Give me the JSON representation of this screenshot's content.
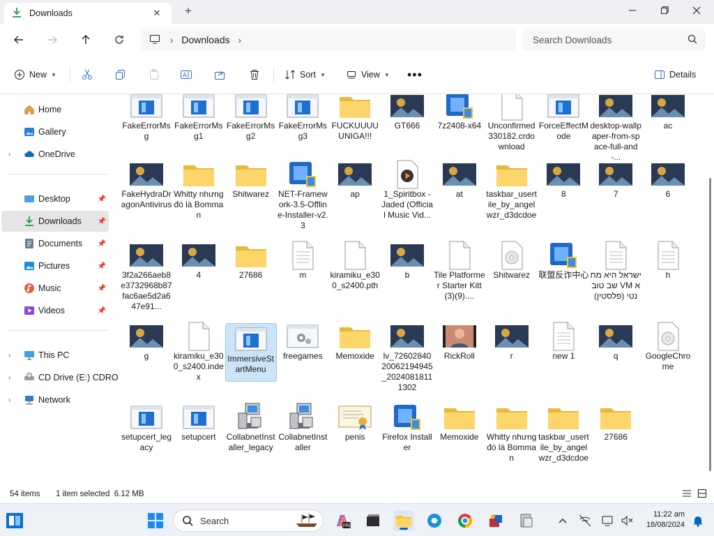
{
  "window": {
    "tab_title": "Downloads",
    "breadcrumb": "Downloads",
    "search_placeholder": "Search Downloads"
  },
  "commands": {
    "new": "New",
    "sort": "Sort",
    "view": "View",
    "details": "Details"
  },
  "sidebar": {
    "items": [
      {
        "label": "Home"
      },
      {
        "label": "Gallery"
      },
      {
        "label": "OneDrive"
      },
      {
        "label": "Desktop"
      },
      {
        "label": "Downloads"
      },
      {
        "label": "Documents"
      },
      {
        "label": "Pictures"
      },
      {
        "label": "Music"
      },
      {
        "label": "Videos"
      },
      {
        "label": "This PC"
      },
      {
        "label": "CD Drive (E:) CDRO"
      },
      {
        "label": "Network"
      }
    ]
  },
  "files": [
    {
      "name": "FakeErrorMsg",
      "icon": "app"
    },
    {
      "name": "FakeErrorMsg1",
      "icon": "app"
    },
    {
      "name": "FakeErrorMsg2",
      "icon": "app"
    },
    {
      "name": "FakeErrorMsg3",
      "icon": "app"
    },
    {
      "name": "FUCKUUUUUNIGA!!!",
      "icon": "folder"
    },
    {
      "name": "GT666",
      "icon": "image"
    },
    {
      "name": "7z2408-x64",
      "icon": "installer"
    },
    {
      "name": "Unconfirmed 330182.crdownload",
      "icon": "doc"
    },
    {
      "name": "ForceEffectMode",
      "icon": "app"
    },
    {
      "name": "desktop-wallpaper-from-space-full-and-...",
      "icon": "image"
    },
    {
      "name": "ac",
      "icon": "image"
    },
    {
      "name": "FakeHydraDragonAntivirus",
      "icon": "image"
    },
    {
      "name": "Whitty nhưng đó là Bomman",
      "icon": "folder"
    },
    {
      "name": "Shitwarez",
      "icon": "folder"
    },
    {
      "name": "NET-Framework-3.5-Offline-Installer-v2.3",
      "icon": "installer"
    },
    {
      "name": "ap",
      "icon": "image"
    },
    {
      "name": "1_Spiritbox - Jaded (Official Music Vid...",
      "icon": "media"
    },
    {
      "name": "at",
      "icon": "image"
    },
    {
      "name": "taskbar_usertile_by_angelwzr_d3dcdoe",
      "icon": "folder"
    },
    {
      "name": "8",
      "icon": "image"
    },
    {
      "name": "7",
      "icon": "image"
    },
    {
      "name": "6",
      "icon": "image"
    },
    {
      "name": "3f2a266aeb8e3732968b87fac6ae5d2a647e91...",
      "icon": "image"
    },
    {
      "name": "4",
      "icon": "image"
    },
    {
      "name": "27686",
      "icon": "folder"
    },
    {
      "name": "m",
      "icon": "text"
    },
    {
      "name": "kiramiku_e300_s2400.pth",
      "icon": "doc"
    },
    {
      "name": "b",
      "icon": "image"
    },
    {
      "name": "Tile Platformer Starter Kitt(3)(9)....",
      "icon": "doc"
    },
    {
      "name": "Shitwarez",
      "icon": "disc"
    },
    {
      "name": "联盟反诈中心",
      "icon": "installer"
    },
    {
      "name": "ישראל היא מחשב טוב VM אנטי (פלסטין)",
      "icon": "text"
    },
    {
      "name": "h",
      "icon": "text"
    },
    {
      "name": "g",
      "icon": "image"
    },
    {
      "name": "kiramiku_e300_s2400.index",
      "icon": "doc"
    },
    {
      "name": "ImmersiveStartMenu",
      "icon": "app",
      "selected": true
    },
    {
      "name": "freegames",
      "icon": "settings"
    },
    {
      "name": "Memoxide",
      "icon": "folder"
    },
    {
      "name": "lv_7260284020062194945_20240818111302",
      "icon": "image"
    },
    {
      "name": "RickRoll",
      "icon": "video"
    },
    {
      "name": "r",
      "icon": "image"
    },
    {
      "name": "new 1",
      "icon": "text"
    },
    {
      "name": "q",
      "icon": "image"
    },
    {
      "name": "GoogleChrome",
      "icon": "disc"
    },
    {
      "name": "setupcert_legacy",
      "icon": "app"
    },
    {
      "name": "setupcert",
      "icon": "app"
    },
    {
      "name": "CollabnetInstaller_legacy",
      "icon": "network"
    },
    {
      "name": "CollabnetInstaller",
      "icon": "network"
    },
    {
      "name": "penis",
      "icon": "cert"
    },
    {
      "name": "Firefox Installer",
      "icon": "installer"
    },
    {
      "name": "Memoxide",
      "icon": "folder"
    },
    {
      "name": "Whitty nhưng đó là Bomman",
      "icon": "folder"
    },
    {
      "name": "taskbar_usertile_by_angelwzr_d3dcdoe",
      "icon": "folder"
    },
    {
      "name": "27686",
      "icon": "folder"
    }
  ],
  "status": {
    "item_count": "54 items",
    "selection": "1 item selected  6.12 MB"
  },
  "taskbar": {
    "search_placeholder": "Search",
    "time": "11:22 am",
    "date": "18/08/2024"
  },
  "colors": {
    "accent": "#0067c0",
    "folder": "#f5c542",
    "selection": "#cce4f7"
  }
}
